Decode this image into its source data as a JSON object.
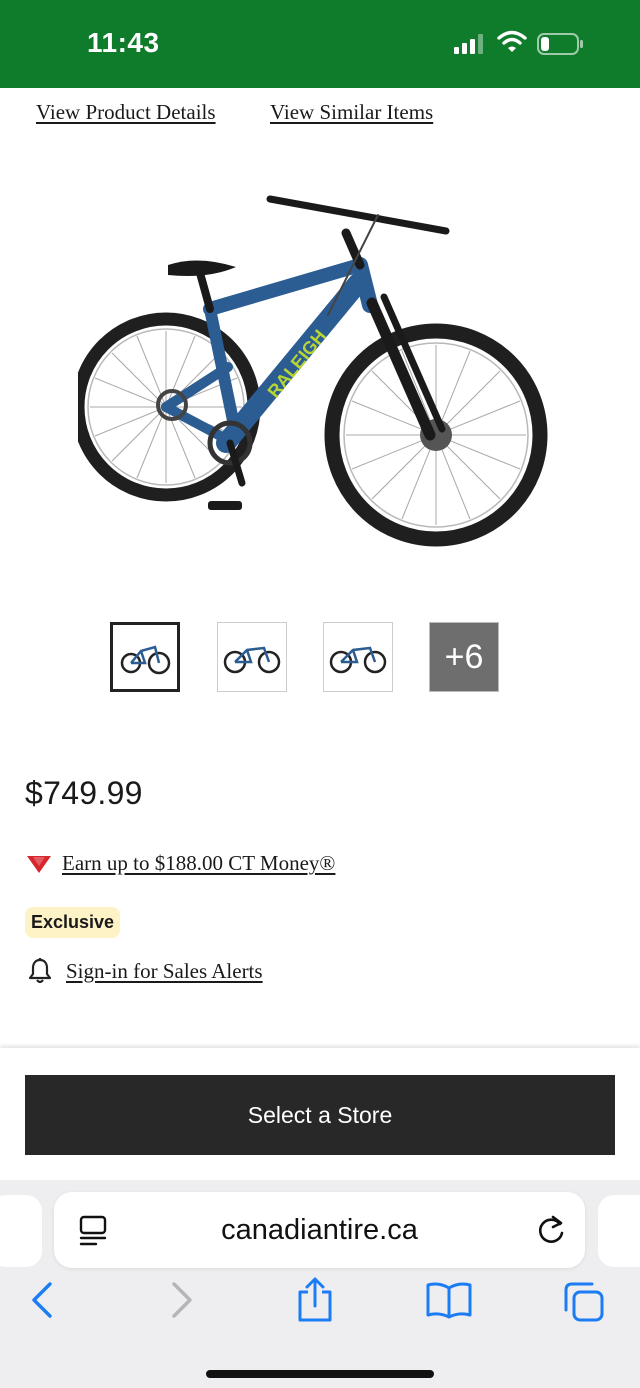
{
  "status_bar": {
    "time": "11:43"
  },
  "nav": {
    "product_details": "View Product Details",
    "similar_items": "View Similar Items"
  },
  "product": {
    "image": "mountain-bike-image",
    "brand_mark": "RALEIGH",
    "thumbnails": [
      "bike-front-thumbnail",
      "bike-side-thumbnail",
      "bike-angle-thumbnail"
    ],
    "more_count": "+6",
    "price": "$749.99",
    "ct_money": "Earn up to $188.00 CT Money®",
    "badge": "Exclusive",
    "sales_alerts": "Sign-in for Sales Alerts"
  },
  "actions": {
    "select_store": "Select a Store"
  },
  "browser": {
    "url": "canadiantire.ca"
  },
  "colors": {
    "status_bar": "#0e7c2a",
    "button": "#282828",
    "badge_bg": "#fdf3c7",
    "ct_triangle": "#d8262e",
    "ios_blue": "#1c7cf4"
  },
  "icons": [
    "signal-icon",
    "wifi-icon",
    "battery-icon",
    "ct-triangle-icon",
    "bell-icon",
    "reader-icon",
    "reload-icon",
    "back-icon",
    "forward-icon",
    "share-icon",
    "bookmarks-icon",
    "tabs-icon"
  ]
}
